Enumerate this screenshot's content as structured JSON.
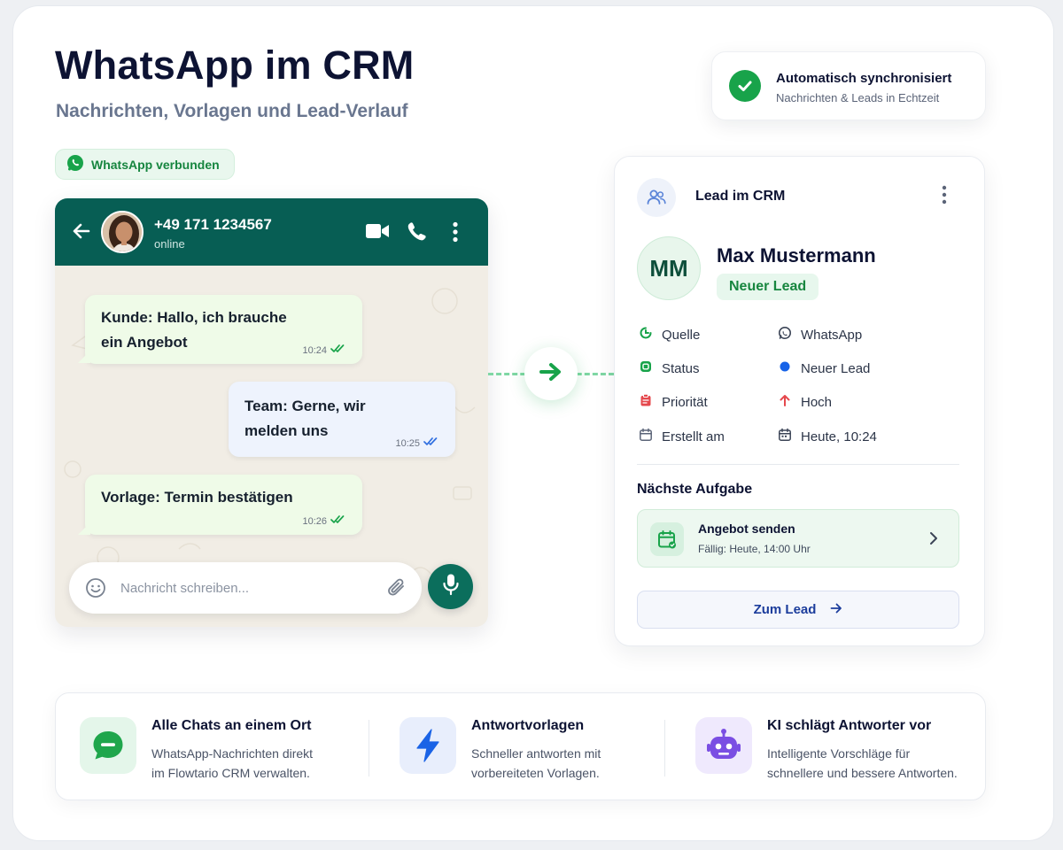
{
  "header": {
    "title": "WhatsApp im CRM",
    "subtitle": "Nachrichten, Vorlagen und Lead-Verlauf"
  },
  "sync": {
    "title": "Automatisch synchronisiert",
    "subtitle": "Nachrichten & Leads in Echtzeit"
  },
  "wa_badge": "WhatsApp verbunden",
  "chat": {
    "contact_number": "+49 171 1234567",
    "status": "online",
    "messages": [
      {
        "direction": "incoming",
        "text_line1": "Kunde: Hallo, ich brauche",
        "text_line2": "ein Angebot",
        "time": "10:24"
      },
      {
        "direction": "outgoing",
        "text_line1": "Team: Gerne, wir",
        "text_line2": "melden uns",
        "time": "10:25"
      },
      {
        "direction": "incoming",
        "text_line1": "Vorlage: Termin bestätigen",
        "text_line2": "",
        "time": "10:26"
      }
    ],
    "composer_placeholder": "Nachricht schreiben..."
  },
  "lead": {
    "header": "Lead im CRM",
    "initials": "MM",
    "name": "Max Mustermann",
    "status_pill": "Neuer Lead",
    "fields": [
      {
        "label": "Quelle",
        "value": "WhatsApp"
      },
      {
        "label": "Status",
        "value": "Neuer Lead"
      },
      {
        "label": "Priorität",
        "value": "Hoch"
      },
      {
        "label": "Erstellt am",
        "value": "Heute, 10:24"
      }
    ],
    "next_task_heading": "Nächste Aufgabe",
    "task": {
      "title": "Angebot senden",
      "due": "Fällig: Heute, 14:00 Uhr"
    },
    "cta": "Zum Lead"
  },
  "features": [
    {
      "title": "Alle Chats an einem Ort",
      "desc_line1": "WhatsApp-Nachrichten direkt",
      "desc_line2": "im Flowtario CRM verwalten.",
      "icon": "chat-bubble-icon"
    },
    {
      "title": "Antwortvorlagen",
      "desc_line1": "Schneller antworten mit",
      "desc_line2": "vorbereiteten Vorlagen.",
      "icon": "lightning-icon"
    },
    {
      "title": "KI schlägt Antworter vor",
      "desc_line1": "Intelligente Vorschläge für",
      "desc_line2": "schnellere und bessere Antworten.",
      "icon": "robot-icon"
    }
  ],
  "colors": {
    "whatsapp_header": "#075e54",
    "accent_green": "#18a34a",
    "incoming_bubble": "#effbe8",
    "outgoing_bubble": "#eef3fd",
    "cta_blue": "#1c3d9c"
  }
}
